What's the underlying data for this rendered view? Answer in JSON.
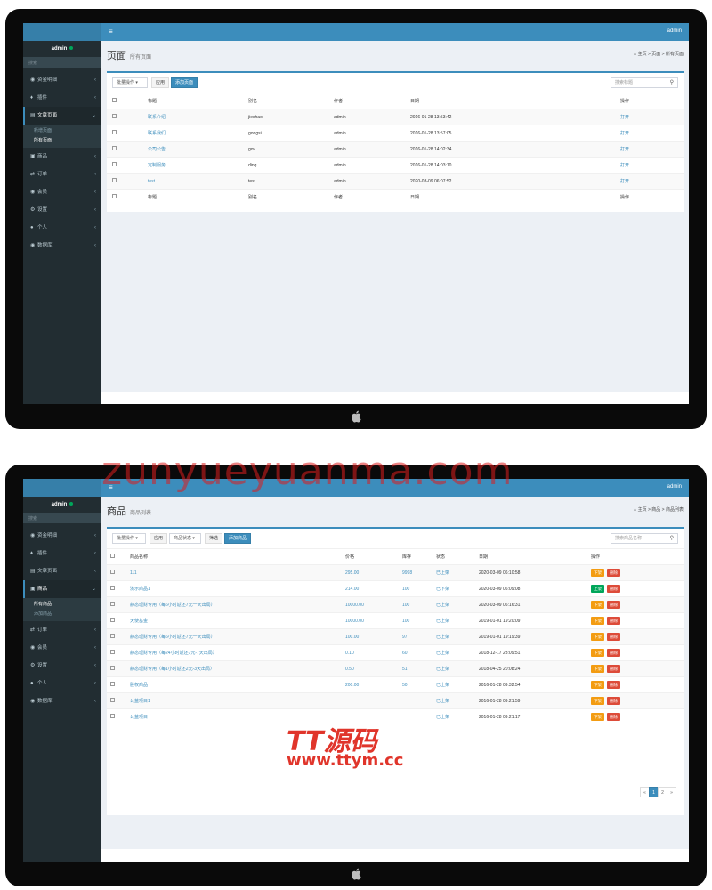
{
  "topbar": {
    "menu_icon": "≡",
    "user": "admin"
  },
  "sidebar": {
    "user": "admin",
    "search_placeholder": "搜索",
    "items": [
      {
        "icon": "users-icon",
        "label": "资金明细"
      },
      {
        "icon": "dollar-icon",
        "label": "插件"
      },
      {
        "icon": "page-icon",
        "label": "文章页面"
      },
      {
        "icon": "cart-icon",
        "label": "商品"
      },
      {
        "icon": "exchange-icon",
        "label": "订单"
      },
      {
        "icon": "users-icon",
        "label": "会员"
      },
      {
        "icon": "gear-icon",
        "label": "设置"
      },
      {
        "icon": "user-icon",
        "label": "个人"
      },
      {
        "icon": "database-icon",
        "label": "数据库"
      }
    ],
    "pages_sub": [
      "新增页面",
      "所有页面"
    ],
    "goods_sub": [
      "所有商品",
      "添加商品"
    ]
  },
  "screen1": {
    "title": "页面",
    "subtitle": "所有页面",
    "breadcrumb": "主页 > 页面 > 所有页面",
    "toolbar": {
      "bulk_select": "批量操作",
      "apply": "应用",
      "add": "添加页面",
      "search_placeholder": "搜索标题"
    },
    "columns": [
      "标题",
      "别名",
      "作者",
      "日期",
      "操作"
    ],
    "rows": [
      {
        "title": "联系介绍",
        "alias": "jieshao",
        "author": "admin",
        "date": "2016-01-28 13:53:42",
        "op": "打开"
      },
      {
        "title": "联系我们",
        "alias": "gongsi",
        "author": "admin",
        "date": "2016-01-28 13:57:05",
        "op": "打开"
      },
      {
        "title": "公司公告",
        "alias": "gov",
        "author": "admin",
        "date": "2016-01-28 14:02:34",
        "op": "打开"
      },
      {
        "title": "定制服务",
        "alias": "ding",
        "author": "admin",
        "date": "2016-01-28 14:03:10",
        "op": "打开"
      },
      {
        "title": "test",
        "alias": "test",
        "author": "admin",
        "date": "2020-03-09 06:07:52",
        "op": "打开"
      }
    ]
  },
  "screen2": {
    "title": "商品",
    "subtitle": "商品列表",
    "breadcrumb": "主页 > 商品 > 商品列表",
    "toolbar": {
      "bulk_select": "批量操作",
      "apply": "应用",
      "status_select": "商品状态",
      "filter": "筛选",
      "add": "添加商品",
      "search_placeholder": "搜索商品名称"
    },
    "columns": [
      "商品名称",
      "价格",
      "库存",
      "状态",
      "日期",
      "操作"
    ],
    "rows": [
      {
        "name": "111",
        "price": "295.00",
        "stock": "9998",
        "status": "已上架",
        "date": "2020-03-09 06:10:58",
        "action": "下架",
        "action_style": "warn",
        "delete": "删除"
      },
      {
        "name": "演示商品1",
        "price": "214.00",
        "stock": "100",
        "status": "已下架",
        "date": "2020-03-09 06:09:08",
        "action": "上架",
        "action_style": "succ",
        "delete": "删除"
      },
      {
        "name": "静态理财专用（每6小时返还7元一天出局）",
        "price": "10000.00",
        "stock": "100",
        "status": "已上架",
        "date": "2020-03-09 06:16:31",
        "action": "下架",
        "action_style": "warn",
        "delete": "删除"
      },
      {
        "name": "天使基金",
        "price": "10000.00",
        "stock": "100",
        "status": "已上架",
        "date": "2019-01-01 19:20:09",
        "action": "下架",
        "action_style": "warn",
        "delete": "删除"
      },
      {
        "name": "静态理财专用（每6小时返还7元一天出局）",
        "price": "100.00",
        "stock": "97",
        "status": "已上架",
        "date": "2019-01-01 19:19:39",
        "action": "下架",
        "action_style": "warn",
        "delete": "删除"
      },
      {
        "name": "静态理财专用（每24小时返还7元-7天出局）",
        "price": "0.10",
        "stock": "60",
        "status": "已上架",
        "date": "2018-12-17 23:09:51",
        "action": "下架",
        "action_style": "warn",
        "delete": "删除"
      },
      {
        "name": "静态理财专用（每1小时返还2元-3天出局）",
        "price": "0.50",
        "stock": "51",
        "status": "已上架",
        "date": "2018-04-25 20:08:24",
        "action": "下架",
        "action_style": "warn",
        "delete": "删除"
      },
      {
        "name": "股权商品",
        "price": "200.00",
        "stock": "50",
        "status": "已上架",
        "date": "2016-01-28 09:32:54",
        "action": "下架",
        "action_style": "warn",
        "delete": "删除"
      },
      {
        "name": "公益项目1",
        "price": "",
        "stock": "",
        "status": "已上架",
        "date": "2016-01-28 09:21:59",
        "action": "下架",
        "action_style": "warn",
        "delete": "删除"
      },
      {
        "name": "公益项目",
        "price": "",
        "stock": "",
        "status": "已上架",
        "date": "2016-01-28 09:21:17",
        "action": "下架",
        "action_style": "warn",
        "delete": "删除"
      }
    ],
    "pagination": [
      "«",
      "1",
      "2",
      "»"
    ],
    "current_page": "1"
  },
  "watermark": {
    "url": "zunyueyuanma.com",
    "logo": "TT源码",
    "site": "www.ttym.cc"
  }
}
